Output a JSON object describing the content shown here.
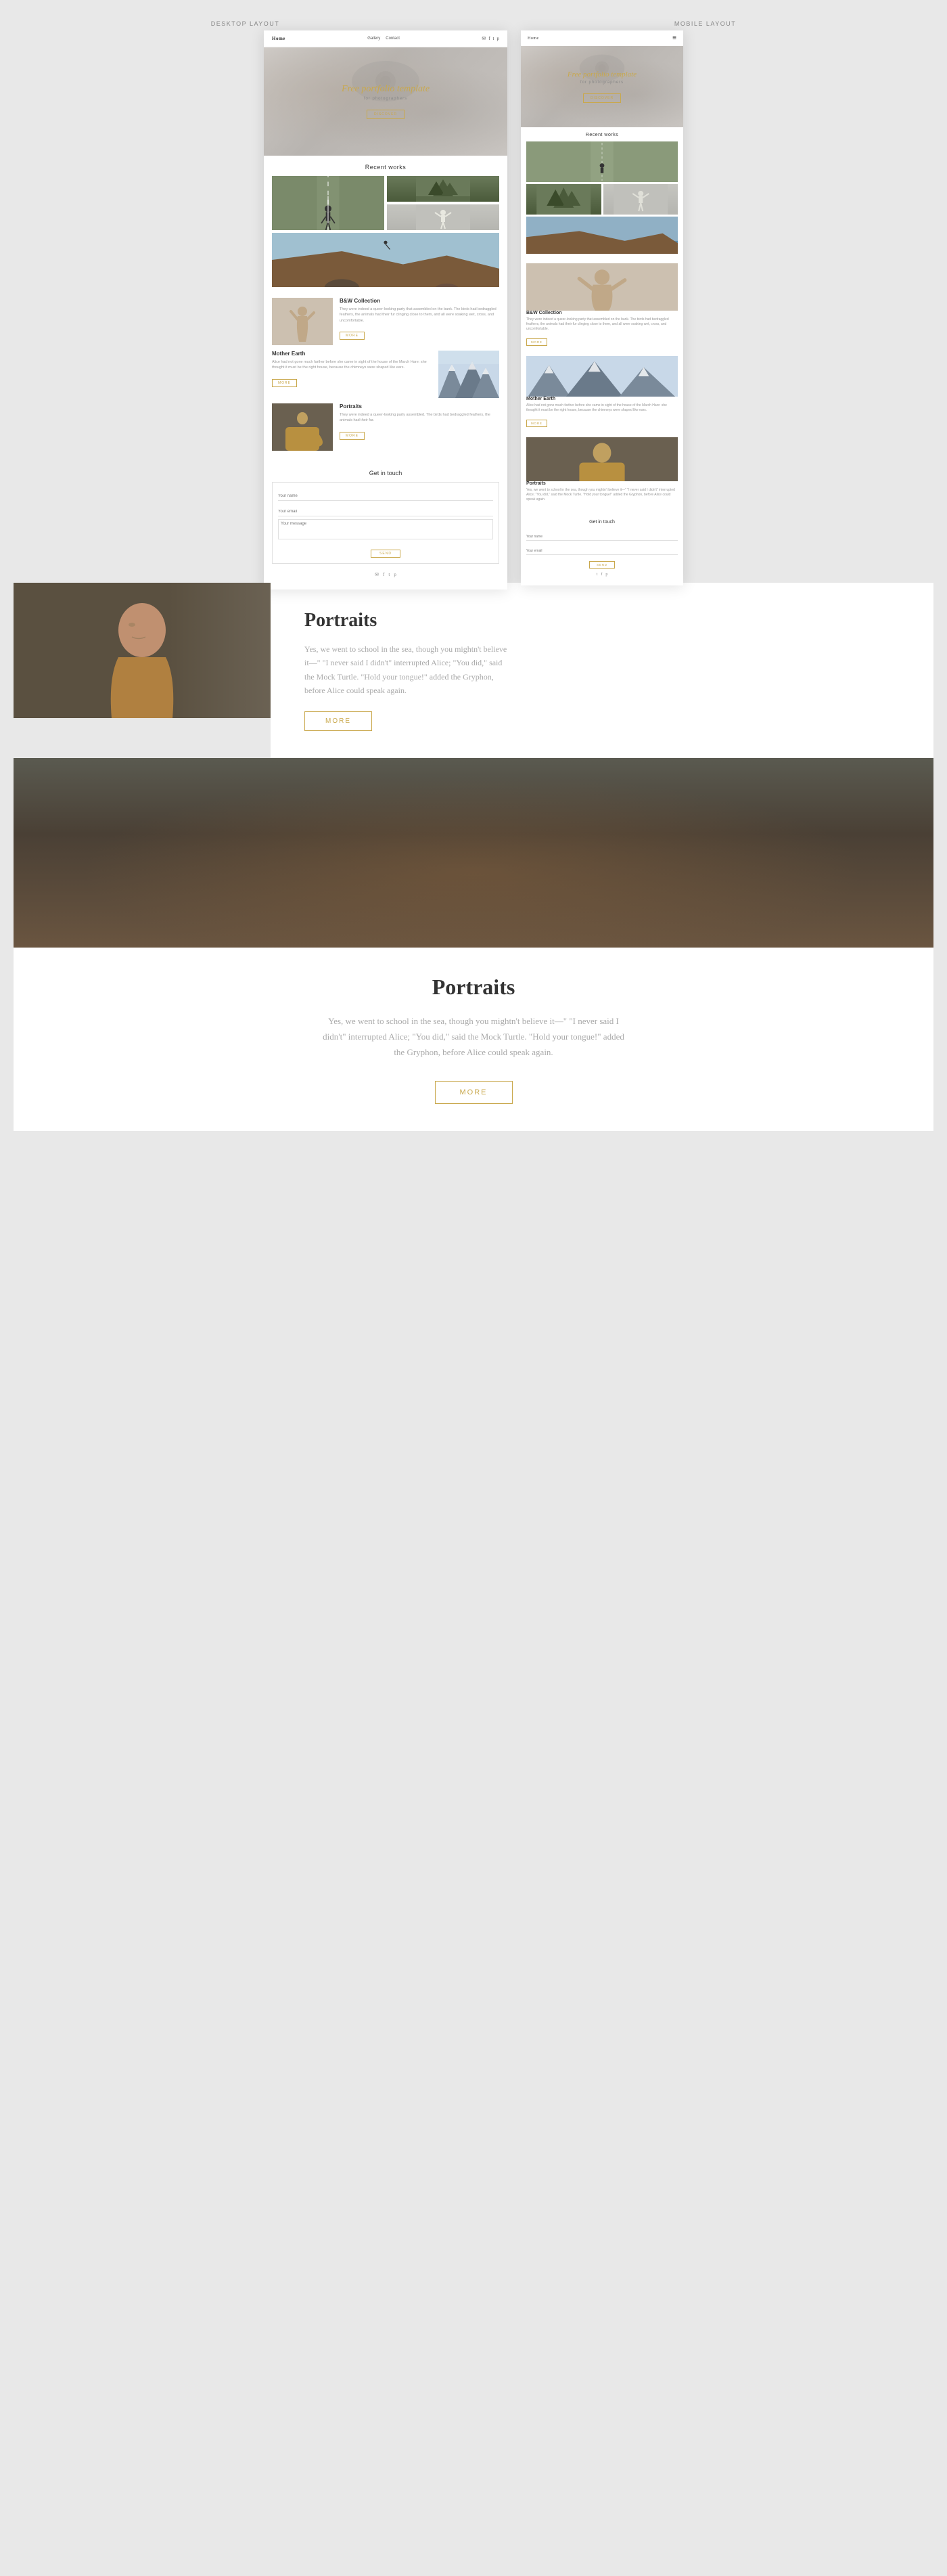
{
  "labels": {
    "desktop": "DESKTOP LAYOUT",
    "mobile": "MOBILE LAYOUT"
  },
  "nav": {
    "logo": "Home",
    "links": [
      "Gallery",
      "Contact"
    ],
    "icons": [
      "f",
      "t",
      "p"
    ]
  },
  "hero": {
    "title": "Free portfolio template",
    "subtitle": "for photographers",
    "btn": "DISCOVER"
  },
  "recent_works": {
    "title": "Recent works"
  },
  "bw_collection": {
    "title": "B&W Collection",
    "desc": "They were indeed a queer-looking party that assembled on the bank. The birds had bedraggled feathers, the animals had their fur clinging close to them, and all were soaking wet, cross, and uncomfortable.",
    "btn": "MORE"
  },
  "mother_earth": {
    "title": "Mother Earth",
    "desc": "Alice had not gone much farther before she came in sight of the house of the March Hare: she thought it must be the right house, because the chimneys were shaped like ears.",
    "btn": "MORE"
  },
  "portraits": {
    "title": "Portraits",
    "desc_short": "They were indeed a queer-looking party assembled. The birds had bedraggled feathers, the animals had their fur.",
    "desc_long": "Yes, we went to school in the sea, though you mightn't believe it—\" \"I never said I didn't\" interrupted Alice; \"You did,\" said the Mock Turtle. \"Hold your tongue!\" added the Gryphon, before Alice could speak again.",
    "btn": "MORE"
  },
  "contact": {
    "title": "Get in touch",
    "fields": {
      "name": "Your name",
      "email": "Your email",
      "message": "Your message"
    },
    "btn": "SEND"
  },
  "footer": {
    "icons": [
      "✉",
      "f",
      "t",
      "p"
    ]
  },
  "portraits_page": {
    "title": "Portraits",
    "desc": "Yes, we went to school in the sea, though you mightn't believe it—\" \"I never said I didn't\" interrupted Alice; \"You did,\" said the Mock Turtle. \"Hold your tongue!\" added the Gryphon, before Alice could speak again.",
    "btn": "MORE"
  },
  "colors": {
    "accent": "#c9a84c",
    "text_dark": "#333333",
    "text_light": "#999999",
    "border": "#e0e0e0"
  }
}
